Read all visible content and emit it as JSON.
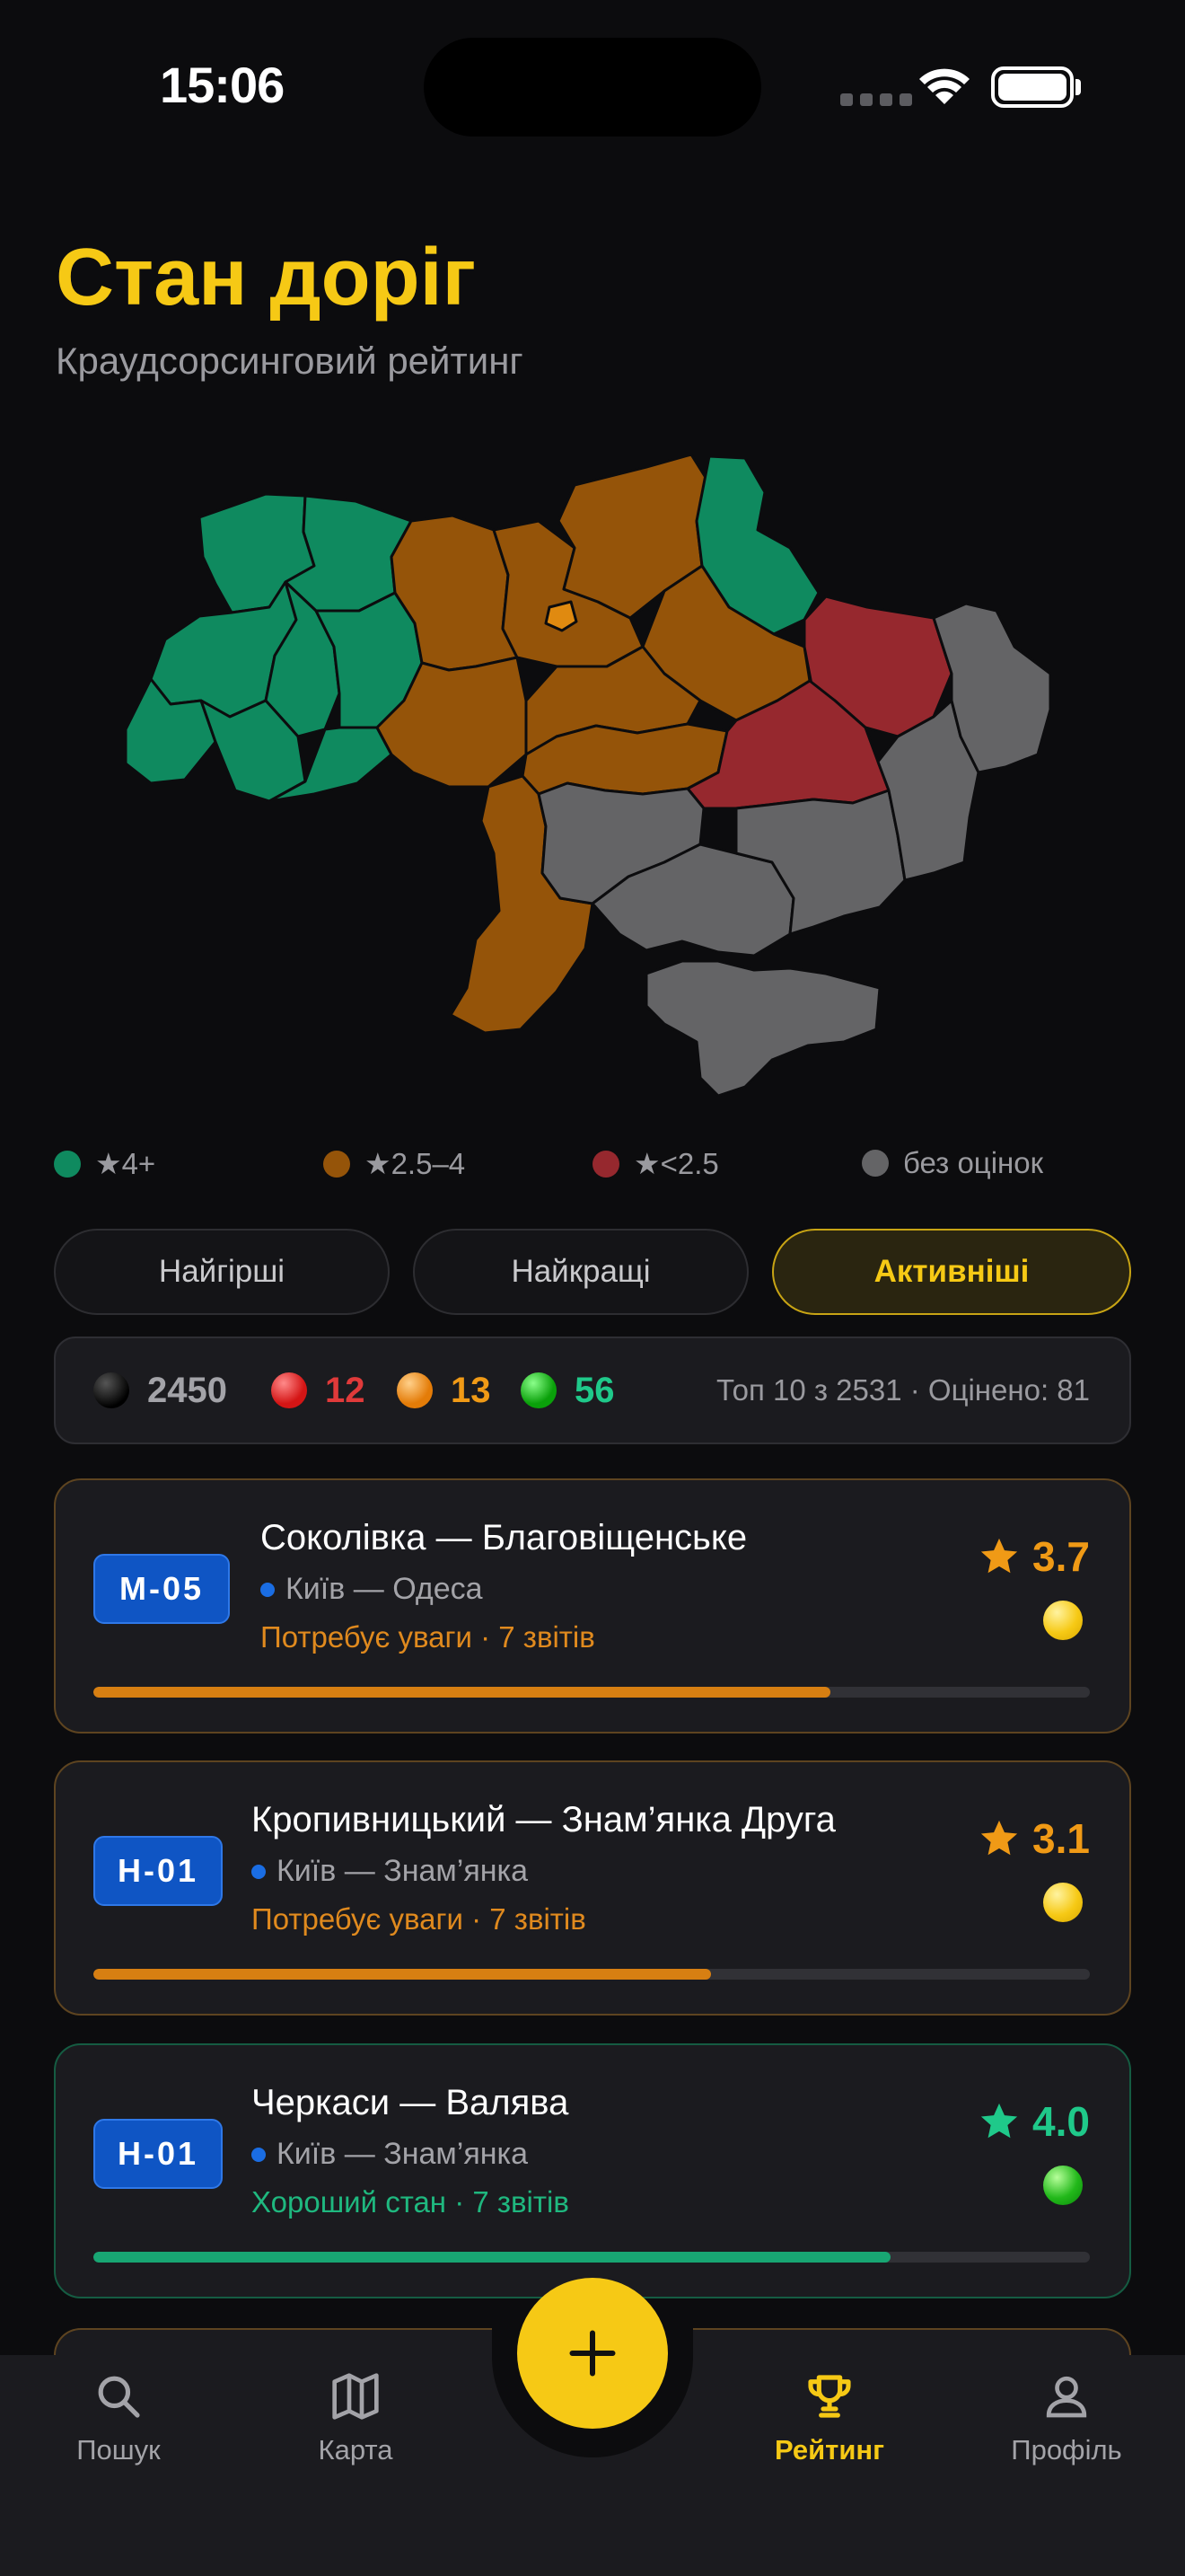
{
  "status_bar": {
    "time": "15:06"
  },
  "header": {
    "title": "Стан доріг",
    "subtitle": "Краудсорсинговий рейтинг"
  },
  "colors": {
    "good": "#0f8a5f",
    "medium": "#955409",
    "bad": "#96282e",
    "none": "#646466",
    "accent": "#f6c915"
  },
  "legend": [
    {
      "label": "★4+",
      "color": "#0f8a5f"
    },
    {
      "label": "★2.5–4",
      "color": "#955409"
    },
    {
      "label": "★<2.5",
      "color": "#96282e"
    },
    {
      "label": "без оцінок",
      "color": "#646466"
    }
  ],
  "tabs": [
    {
      "label": "Найгірші",
      "active": false
    },
    {
      "label": "Найкращі",
      "active": false
    },
    {
      "label": "Активніші",
      "active": true
    }
  ],
  "stats": {
    "black": "2450",
    "red": "12",
    "orange": "13",
    "green": "56",
    "summary": "Топ 10 з 2531 · Оцінено: 81"
  },
  "roads": [
    {
      "code": "М-05",
      "title": "Соколівка — Благовіщенське",
      "route": "Київ — Одеса",
      "status": "Потребує уваги · 7 звітів",
      "rating": "3.7",
      "progress": 0.74,
      "condition": "medium"
    },
    {
      "code": "Н-01",
      "title": "Кропивницький — Знам’янка Друга",
      "route": "Київ — Знам’янка",
      "status": "Потребує уваги · 7 звітів",
      "rating": "3.1",
      "progress": 0.62,
      "condition": "medium"
    },
    {
      "code": "Н-01",
      "title": "Черкаси — Валява",
      "route": "Київ — Знам’янка",
      "status": "Хороший стан · 7 звітів",
      "rating": "4.0",
      "progress": 0.8,
      "condition": "good"
    }
  ],
  "nav": {
    "search": "Пошук",
    "map": "Карта",
    "rating": "Рейтинг",
    "profile": "Профіль"
  },
  "icons": [
    "search-icon",
    "map-icon",
    "trophy-icon",
    "profile-icon",
    "plus-icon",
    "star-icon",
    "wifi-icon",
    "battery-icon"
  ]
}
